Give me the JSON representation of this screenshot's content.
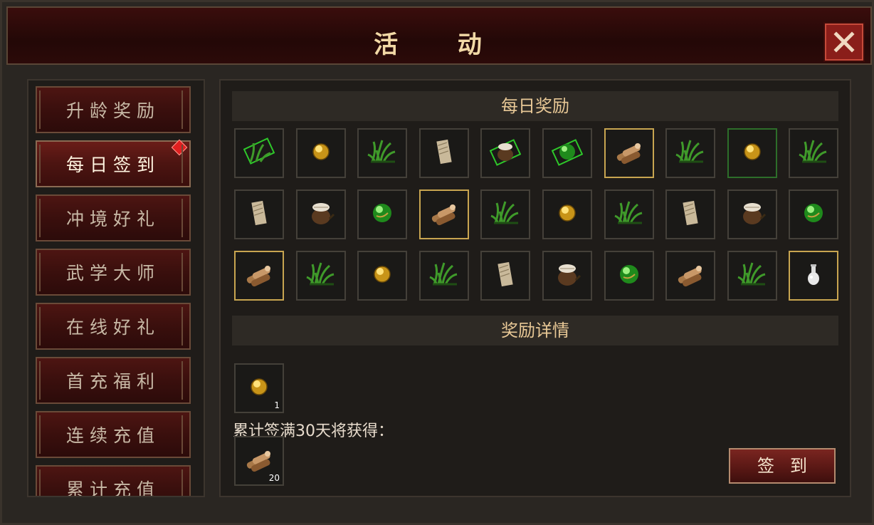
{
  "window": {
    "title": "活 动",
    "close_icon": "close-icon"
  },
  "sidebar": {
    "items": [
      {
        "label": "升龄奖励"
      },
      {
        "label": "每日签到",
        "active": true,
        "badge": "red-diamond"
      },
      {
        "label": "冲境好礼"
      },
      {
        "label": "武学大师"
      },
      {
        "label": "在线好礼"
      },
      {
        "label": "首充福利"
      },
      {
        "label": "连续充值"
      },
      {
        "label": "累计充值"
      }
    ]
  },
  "main": {
    "daily_header": "每日奖励",
    "detail_header": "奖励详情",
    "reward_grid": [
      [
        "grass-ticket",
        "gold-pearl",
        "grass",
        "paper",
        "grass-ticket-sack",
        "green-orb-ticket",
        "wood-bundle",
        "grass",
        "gold-pearl",
        "grass"
      ],
      [
        "paper",
        "sack",
        "green-orb",
        "wood-bundle",
        "grass",
        "gold-pearl",
        "grass",
        "paper",
        "sack",
        "green-orb"
      ],
      [
        "wood-bundle",
        "grass",
        "gold-pearl",
        "grass",
        "paper",
        "sack",
        "green-orb",
        "wood-bundle",
        "grass",
        "white-vase"
      ]
    ],
    "highlighted": {
      "gold": [
        "0-6",
        "1-3",
        "2-0",
        "2-9"
      ],
      "green": [
        "0-8"
      ]
    },
    "detail_item": {
      "icon": "gold-pearl",
      "count": "1"
    },
    "cumulative_text": "累计签满30天将获得：",
    "cumulative_item": {
      "icon": "wood-bundle",
      "count": "20"
    },
    "sign_button": "签到"
  },
  "colors": {
    "accent": "#e8c896",
    "frame": "#2a2622",
    "button_red": "#5a1815"
  }
}
